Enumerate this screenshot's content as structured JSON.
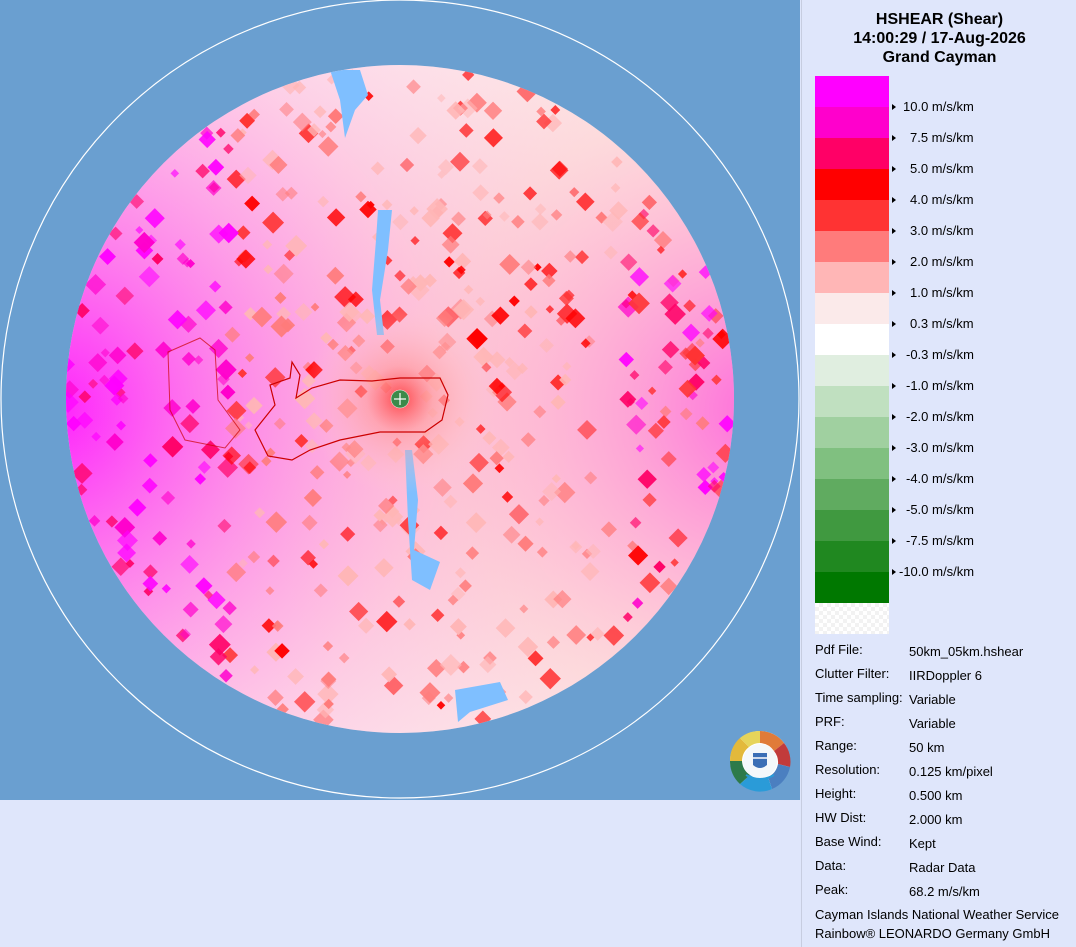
{
  "header": {
    "title": "HSHEAR (Shear)",
    "datetime": "14:00:29 / 17-Aug-2026",
    "location": "Grand Cayman"
  },
  "legend": [
    {
      "label": "",
      "color": "#ff00ff"
    },
    {
      "label": "10.0 m/s/km",
      "color": "#ff00cc"
    },
    {
      "label": "7.5 m/s/km",
      "color": "#ff0066"
    },
    {
      "label": "5.0 m/s/km",
      "color": "#ff0000"
    },
    {
      "label": "4.0 m/s/km",
      "color": "#ff3333"
    },
    {
      "label": "3.0 m/s/km",
      "color": "#ff7b7b"
    },
    {
      "label": "2.0 m/s/km",
      "color": "#ffb6b6"
    },
    {
      "label": "1.0 m/s/km",
      "color": "#fbeaea"
    },
    {
      "label": "0.3 m/s/km",
      "color": "#ffffff"
    },
    {
      "label": "-0.3 m/s/km",
      "color": "#e0eee0"
    },
    {
      "label": "-1.0 m/s/km",
      "color": "#c0e0c0"
    },
    {
      "label": "-2.0 m/s/km",
      "color": "#a0d0a0"
    },
    {
      "label": "-3.0 m/s/km",
      "color": "#80c080"
    },
    {
      "label": "-4.0 m/s/km",
      "color": "#60ab60"
    },
    {
      "label": "-5.0 m/s/km",
      "color": "#409940"
    },
    {
      "label": "-7.5 m/s/km",
      "color": "#208820"
    },
    {
      "label": "-10.0 m/s/km",
      "color": "#007800"
    },
    {
      "label": "",
      "color": "checker"
    }
  ],
  "info": [
    {
      "key": "Pdf File:",
      "value": "50km_05km.hshear"
    },
    {
      "key": "Clutter Filter:",
      "value": "IIRDoppler 6"
    },
    {
      "key": "Time sampling:",
      "value": "Variable"
    },
    {
      "key": "PRF:",
      "value": "Variable"
    },
    {
      "key": "Range:",
      "value": "50 km"
    },
    {
      "key": "Resolution:",
      "value": "0.125 km/pixel"
    },
    {
      "key": "Height:",
      "value": "0.500 km"
    },
    {
      "key": "HW Dist:",
      "value": "2.000 km"
    },
    {
      "key": "Base Wind:",
      "value": "Kept"
    },
    {
      "key": "Data:",
      "value": "Radar Data"
    },
    {
      "key": "Peak:",
      "value": "68.2 m/s/km"
    }
  ],
  "credits": {
    "line1": "Cayman Islands National Weather Service",
    "line2": "Rainbow® LEONARDO Germany GmbH"
  },
  "map": {
    "background_color": "#6a9fd0",
    "range_ring_color": "#ffffff",
    "coastline_color": "#cc0000",
    "radar_site_marker": "green-crosshair-icon"
  }
}
